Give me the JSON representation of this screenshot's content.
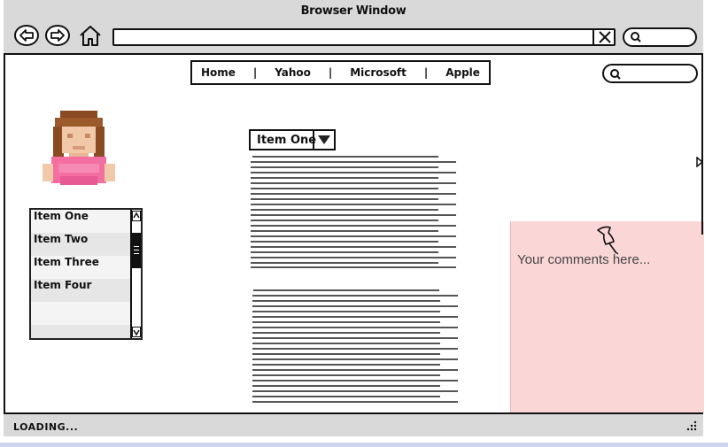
{
  "window": {
    "title": "Browser Window"
  },
  "toolbar": {
    "back_icon": "back-arrow-icon",
    "forward_icon": "forward-arrow-icon",
    "home_icon": "home-icon",
    "clear_icon": "close-x-icon",
    "search_icon": "search-icon",
    "url_value": ""
  },
  "nav": {
    "links": [
      "Home",
      "Yahoo",
      "Microsoft",
      "Apple"
    ],
    "separator": "|"
  },
  "page_search": {
    "icon": "search-icon",
    "value": ""
  },
  "listbox": {
    "items": [
      "Item One",
      "Item Two",
      "Item Three",
      "Item Four"
    ]
  },
  "dropdown": {
    "selected": "Item One"
  },
  "sticky_note": {
    "text": "Your comments here...",
    "icon": "pushpin-icon",
    "color": "#fbd6d6"
  },
  "status": {
    "text": "LOADING..."
  },
  "colors": {
    "chrome_gray": "#d9d9d9",
    "text_line": "#555555"
  }
}
